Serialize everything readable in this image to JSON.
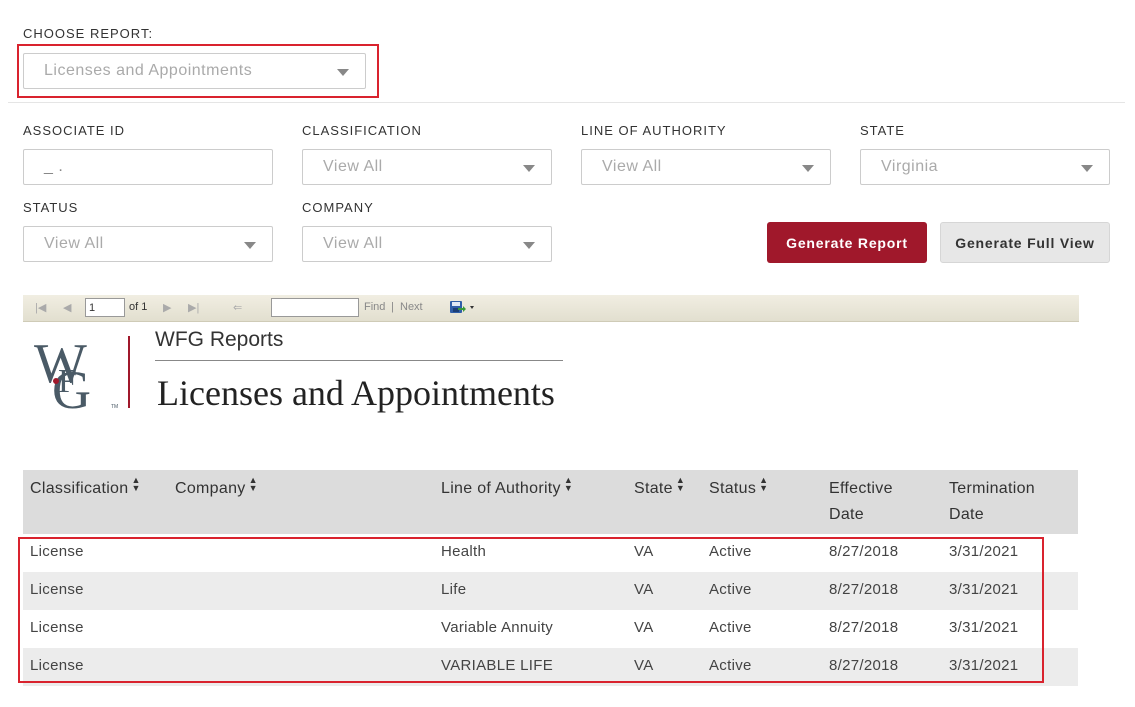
{
  "report_chooser": {
    "label": "CHOOSE REPORT:",
    "selected": "Licenses and Appointments"
  },
  "filters": {
    "associate_id": {
      "label": "ASSOCIATE ID",
      "value": "_ ."
    },
    "classification": {
      "label": "CLASSIFICATION",
      "value": "View All"
    },
    "line_of_authority": {
      "label": "LINE OF AUTHORITY",
      "value": "View All"
    },
    "state": {
      "label": "STATE",
      "value": "Virginia"
    },
    "status": {
      "label": "STATUS",
      "value": "View All"
    },
    "company": {
      "label": "COMPANY",
      "value": "View All"
    }
  },
  "buttons": {
    "generate_report": "Generate Report",
    "generate_full_view": "Generate Full View"
  },
  "toolbar": {
    "page_value": "1",
    "of_pages": "of 1",
    "find_label": "Find",
    "separator": "|",
    "next_label": "Next",
    "find_value": ""
  },
  "report": {
    "logo_text": "WFG",
    "subtitle": "WFG Reports",
    "title": "Licenses and Appointments"
  },
  "table": {
    "headers": {
      "classification": "Classification",
      "company": "Company",
      "line_of_authority": "Line of Authority",
      "state": "State",
      "status": "Status",
      "effective_1": "Effective",
      "effective_2": "Date",
      "termination_1": "Termination",
      "termination_2": "Date"
    },
    "rows": [
      {
        "classification": "License",
        "company": "",
        "line_of_authority": "Health",
        "state": "VA",
        "status": "Active",
        "effective": "8/27/2018",
        "termination": "3/31/2021"
      },
      {
        "classification": "License",
        "company": "",
        "line_of_authority": "Life",
        "state": "VA",
        "status": "Active",
        "effective": "8/27/2018",
        "termination": "3/31/2021"
      },
      {
        "classification": "License",
        "company": "",
        "line_of_authority": "Variable Annuity",
        "state": "VA",
        "status": "Active",
        "effective": "8/27/2018",
        "termination": "3/31/2021"
      },
      {
        "classification": "License",
        "company": "",
        "line_of_authority": "VARIABLE LIFE",
        "state": "VA",
        "status": "Active",
        "effective": "8/27/2018",
        "termination": "3/31/2021"
      }
    ]
  },
  "colors": {
    "accent": "#a0182b",
    "highlight_box": "#d9232e",
    "logo_gray": "#4a5a66"
  }
}
